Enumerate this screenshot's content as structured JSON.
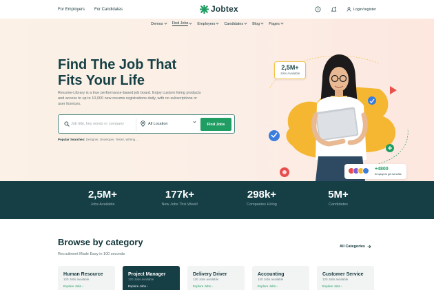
{
  "topbar": {
    "left_links": [
      "For Employers",
      "For Candidates"
    ],
    "logo_text": "Jobtex",
    "login_label": "Login/register"
  },
  "nav": {
    "items": [
      {
        "label": "Demos"
      },
      {
        "label": "Find Jobs"
      },
      {
        "label": "Employers"
      },
      {
        "label": "Candidates"
      },
      {
        "label": "Blog"
      },
      {
        "label": "Pages"
      }
    ]
  },
  "hero": {
    "title_line1": "Find The Job That",
    "title_line2": "Fits Your Life",
    "description": "Resume-Library is a true performance-based job board. Enjoy custom hiring products and access to up to 10,000 new resume registrations daily, with no subscriptions or user licences.",
    "search": {
      "keyword_placeholder": "Job title, key words or company",
      "location_value": "All Location",
      "button_label": "Find Jobs"
    },
    "popular_label": "Popular Searches:",
    "popular_tags": "Designer, Developer, Tester, Writing...",
    "badge_value": "2,5M+",
    "badge_label": "Jobs Available",
    "benefits_value": "+4800",
    "benefits_label": "Employers get benefits"
  },
  "stats": [
    {
      "value": "2,5M+",
      "label": "Jobs Available"
    },
    {
      "value": "177k+",
      "label": "New Jobs This Week!"
    },
    {
      "value": "298k+",
      "label": "Companies Hiring"
    },
    {
      "value": "5M+",
      "label": "Candidates"
    }
  ],
  "categories": {
    "title": "Browse by category",
    "subtitle": "Recruitment Made Easy in 100 seconds",
    "all_label": "All Categories",
    "cards": [
      {
        "title": "Human Resource",
        "count": "120 Jobs available",
        "link": "Explore Jobs"
      },
      {
        "title": "Project Manager",
        "count": "120 Jobs available",
        "link": "Explore Jobs"
      },
      {
        "title": "Delivery Driver",
        "count": "120 Jobs available",
        "link": "Explore Jobs"
      },
      {
        "title": "Accounting",
        "count": "120 Jobs available",
        "link": "Explore Jobs"
      },
      {
        "title": "Customer Service",
        "count": "120 Jobs available",
        "link": "Explore Jobs"
      }
    ]
  },
  "colors": {
    "brand_dark": "#153e45",
    "accent_green": "#1f9d62",
    "accent_yellow": "#f5b731"
  }
}
